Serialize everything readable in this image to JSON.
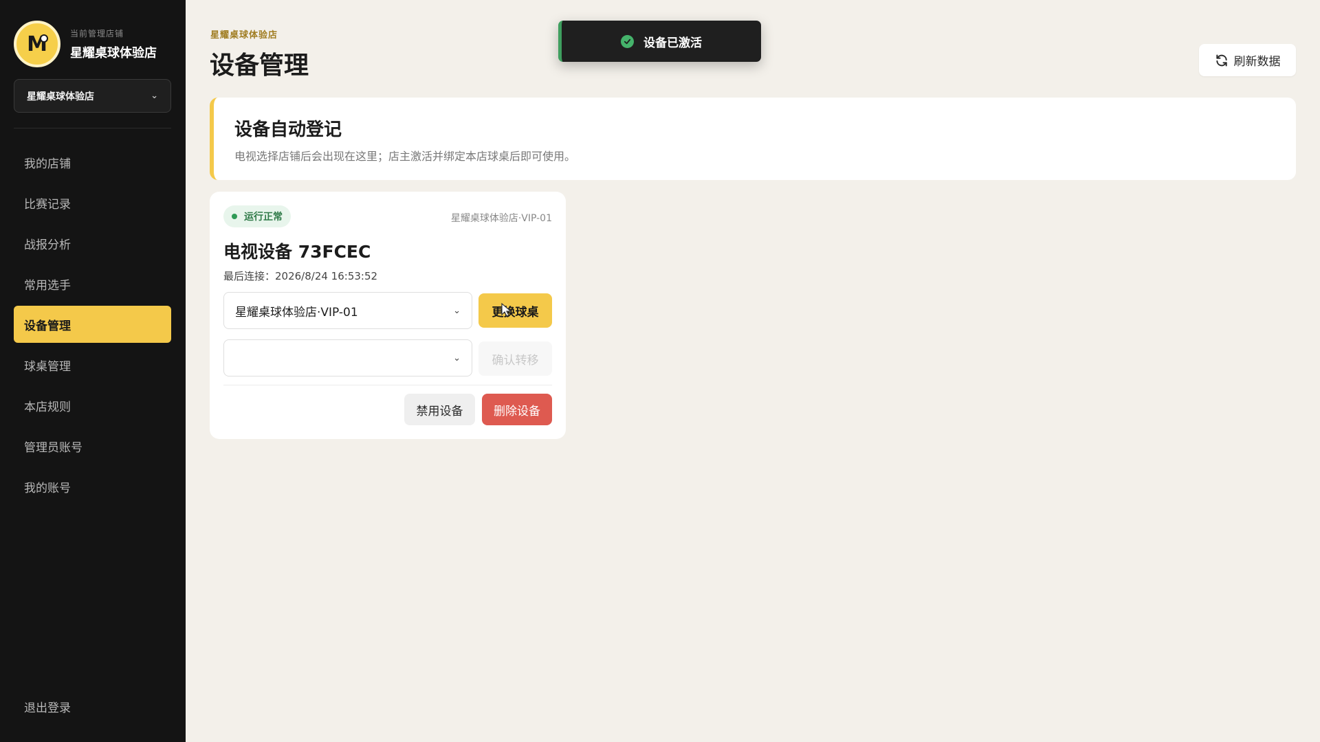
{
  "colors": {
    "accent": "#f4c94a",
    "sidebar_bg": "#141414",
    "danger": "#de5a50",
    "success": "#45b36b",
    "page_bg": "#f3f0ea"
  },
  "sidebar": {
    "brand_sub": "当前管理店铺",
    "brand_name": "星耀桌球体验店",
    "logo_icon": "logo-m",
    "store_select": "星耀桌球体验店",
    "items": [
      {
        "label": "我的店铺"
      },
      {
        "label": "比赛记录"
      },
      {
        "label": "战报分析"
      },
      {
        "label": "常用选手"
      },
      {
        "label": "设备管理",
        "active": true
      },
      {
        "label": "球桌管理"
      },
      {
        "label": "本店规则"
      },
      {
        "label": "管理员账号"
      },
      {
        "label": "我的账号"
      }
    ],
    "logout": "退出登录"
  },
  "header": {
    "breadcrumb": "星耀桌球体验店",
    "title": "设备管理",
    "refresh_label": "刷新数据",
    "refresh_icon": "refresh-icon"
  },
  "toast": {
    "text": "设备已激活",
    "icon": "check-circle-icon"
  },
  "info": {
    "title": "设备自动登记",
    "description": "电视选择店铺后会出现在这里；店主激活并绑定本店球桌后即可使用。"
  },
  "device": {
    "status": "运行正常",
    "location": "星耀桌球体验店·VIP-01",
    "name": "电视设备 73FCEC",
    "last_connected": "最后连接：2026/8/24 16:53:52",
    "table_select": "星耀桌球体验店·VIP-01",
    "transfer_select": "",
    "change_label": "更换球桌",
    "confirm_label": "确认转移",
    "disable_label": "禁用设备",
    "delete_label": "删除设备"
  }
}
